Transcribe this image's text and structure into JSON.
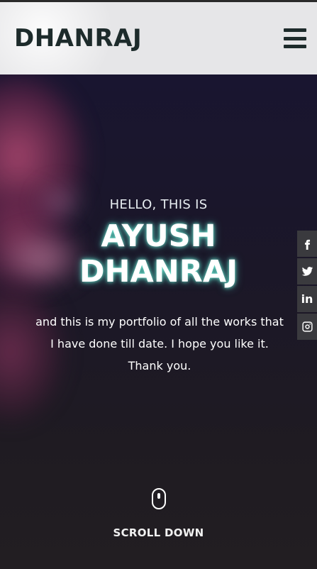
{
  "header": {
    "brand": "DHANRAJ",
    "menu_icon": "hamburger-menu-icon"
  },
  "hero": {
    "greeting": "HELLO, THIS IS",
    "name_line1": "AYUSH",
    "name_line2": "DHANRAJ",
    "intro_line1": "and this is my portfolio of all the works that",
    "intro_line2": "I have done till date. I hope you like it.",
    "intro_line3": "Thank you.",
    "scroll_label": "SCROLL DOWN",
    "scroll_icon": "mouse-scroll-icon"
  },
  "social": {
    "items": [
      {
        "icon": "facebook-icon"
      },
      {
        "icon": "twitter-icon"
      },
      {
        "icon": "linkedin-icon",
        "text": "in"
      },
      {
        "icon": "instagram-icon"
      }
    ]
  },
  "colors": {
    "navbar_bg": "#e6e6e8",
    "brand_text": "#1d2b2b",
    "hero_bg": "#1c1822",
    "name_glow": "#78ffe6",
    "social_bg": "#3a3a3e"
  }
}
